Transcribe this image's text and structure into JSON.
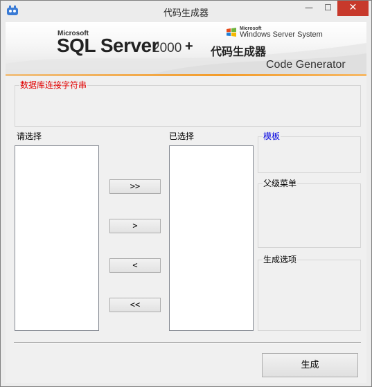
{
  "window": {
    "title": "代码生成器",
    "minimize_glyph": "—",
    "maximize_glyph": "☐",
    "close_glyph": "✕"
  },
  "banner": {
    "microsoft": "Microsoft",
    "sql_server": "SQL Server",
    "version": "2000",
    "plus": "+",
    "cn_title": "代码生成器",
    "wss_microsoft": "Microsoft",
    "wss_name": "Windows Server System",
    "code_generator": "Code Generator"
  },
  "connection": {
    "label": "数据库连接字符串"
  },
  "lists": {
    "available_label": "请选择",
    "selected_label": "已选择"
  },
  "transfer_buttons": {
    "add_all": ">>",
    "add_one": ">",
    "remove_one": "<",
    "remove_all": "<<"
  },
  "options": {
    "template_label": "模板",
    "parent_menu_label": "父级菜单",
    "generate_options_label": "生成选项"
  },
  "actions": {
    "generate": "生成"
  },
  "colors": {
    "connection_label": "#e00000",
    "template_label": "#0000e0",
    "close_button": "#c7392b",
    "banner_accent": "#f39c2a"
  }
}
